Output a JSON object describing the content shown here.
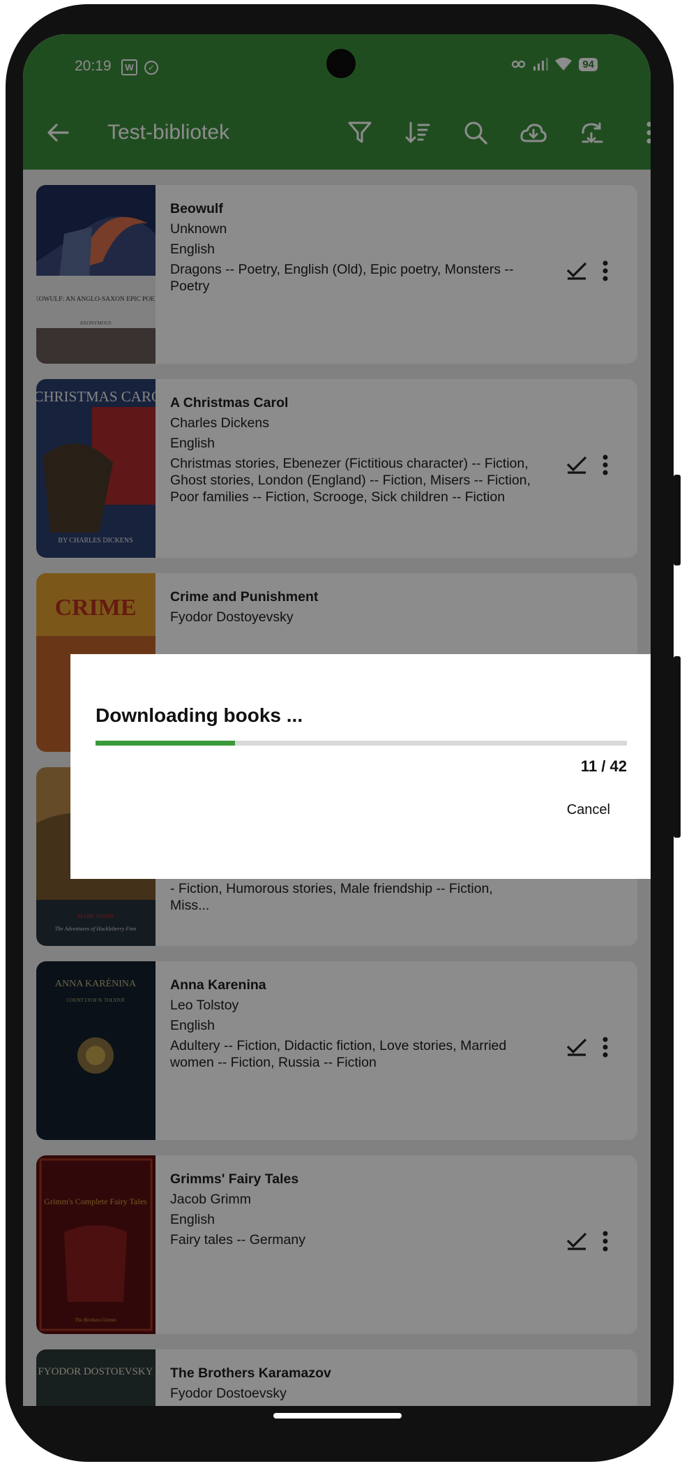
{
  "status_bar": {
    "time": "20:19",
    "notif_w": "W",
    "battery": "94"
  },
  "app_bar": {
    "title": "Test-bibliotek",
    "actions": [
      "filter-icon",
      "sort-icon",
      "search-icon",
      "cloud-download-icon",
      "sync-icon",
      "more-vert-icon"
    ]
  },
  "books": [
    {
      "title": "Beowulf",
      "author": "Unknown",
      "language": "English",
      "subjects": "Dragons -- Poetry, English (Old), Epic poetry, Monsters -- Poetry",
      "cover_text": "BEOWULF: AN ANGLO-SAXON EPIC POEM",
      "cover_sub": "ANONYMOUS"
    },
    {
      "title": "A Christmas Carol",
      "author": "Charles Dickens",
      "language": "English",
      "subjects": "Christmas stories, Ebenezer (Fictitious character) -- Fiction, Ghost stories, London (England) -- Fiction, Misers -- Fiction, Poor families -- Fiction, Scrooge, Sick children -- Fiction",
      "cover_text": "A CHRISTMAS CAROL",
      "cover_sub": "BY CHARLES DICKENS"
    },
    {
      "title": "Crime and Punishment",
      "author": "Fyodor Dostoyevsky",
      "language": "",
      "subjects": "",
      "cover_text": "CRIME",
      "cover_sub": ""
    },
    {
      "title": "",
      "author": "",
      "language": "",
      "subjects": "Adventure stories, Bildungsromans, Boys -- Fiction, Finn, Fugitive slaves -- Fiction, Huckleberry (Fictitious character) -- Fiction, Humorous stories, Male friendship -- Fiction, Miss...",
      "cover_text": "MARK TWAIN",
      "cover_sub": "The Adventures of Huckleberry Finn"
    },
    {
      "title": "Anna Karenina",
      "author": "Leo Tolstoy",
      "language": "English",
      "subjects": "Adultery -- Fiction, Didactic fiction, Love stories, Married women -- Fiction, Russia -- Fiction",
      "cover_text": "ANNA KARÉNINA",
      "cover_sub": "COUNT LYOF N. TOLSTOÏ"
    },
    {
      "title": "Grimms' Fairy Tales",
      "author": "Jacob Grimm",
      "language": "English",
      "subjects": "Fairy tales -- Germany",
      "cover_text": "Grimm's Complete Fairy Tales",
      "cover_sub": "The Brothers Grimm"
    },
    {
      "title": "The Brothers Karamazov",
      "author": "Fyodor Dostoevsky",
      "language": "",
      "subjects": "",
      "cover_text": "FYODOR DOSTOEVSKY",
      "cover_sub": ""
    }
  ],
  "dialog": {
    "title": "Downloading books ...",
    "progress_current": 11,
    "progress_total": 42,
    "count_text": "11 / 42",
    "cancel_label": "Cancel"
  },
  "colors": {
    "app_bar": "#3b8d3b",
    "progress": "#3a9a3a"
  }
}
